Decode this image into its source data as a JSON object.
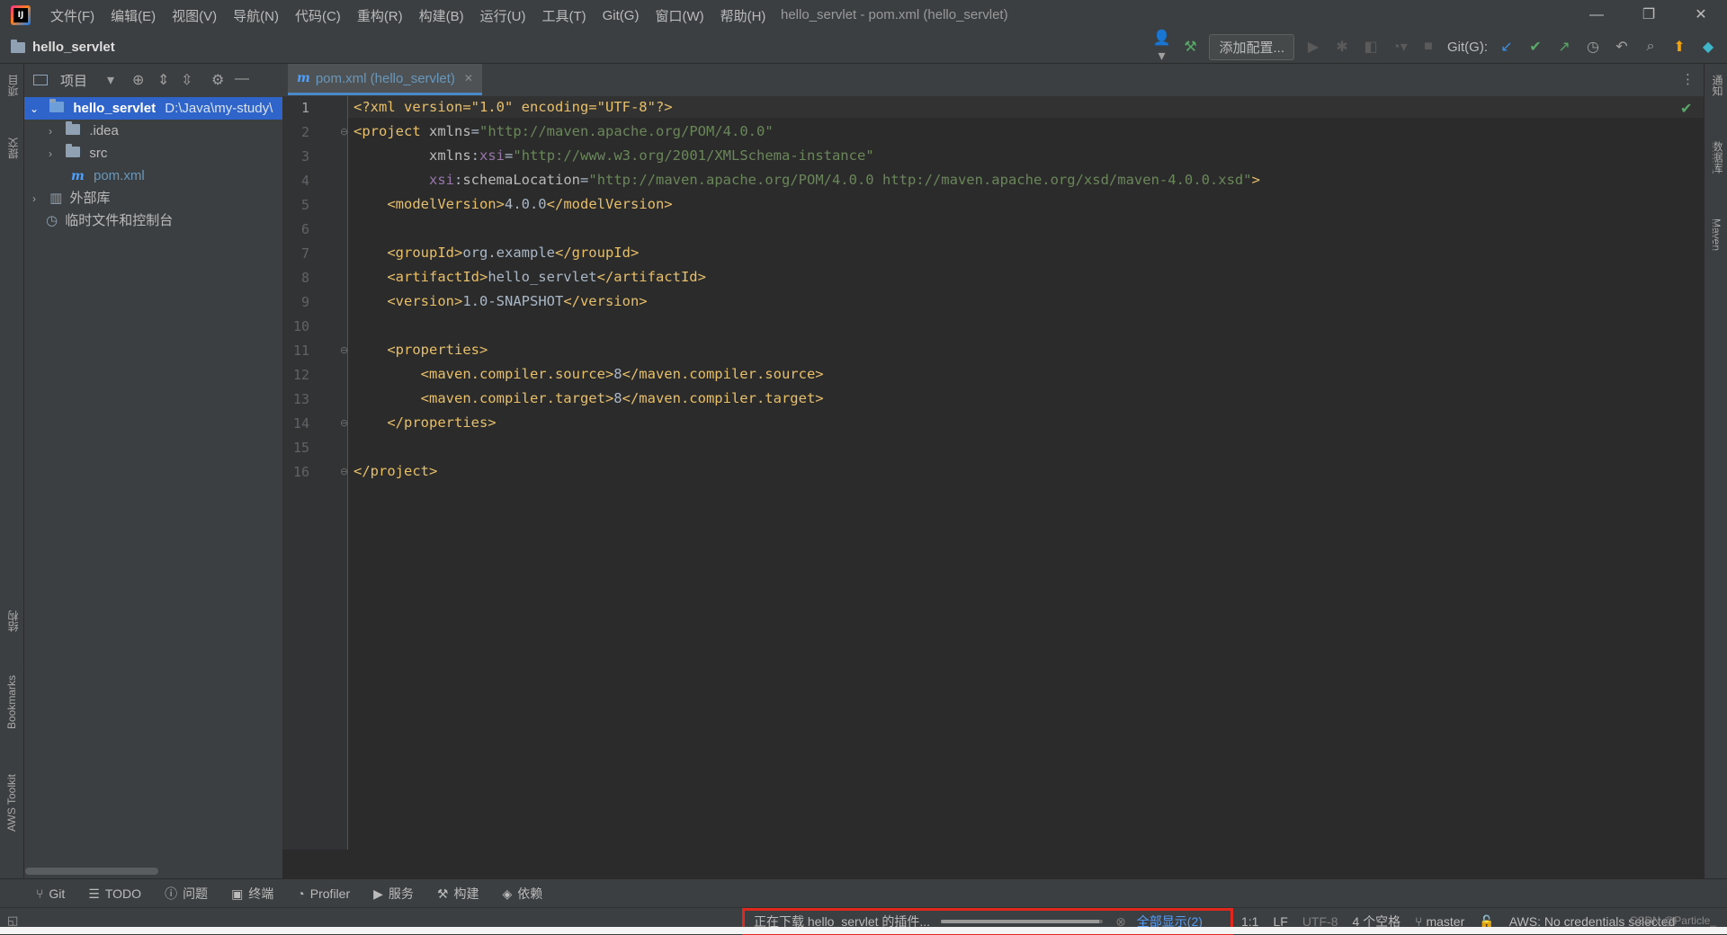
{
  "menu": [
    "文件(F)",
    "编辑(E)",
    "视图(V)",
    "导航(N)",
    "代码(C)",
    "重构(R)",
    "构建(B)",
    "运行(U)",
    "工具(T)",
    "Git(G)",
    "窗口(W)",
    "帮助(H)"
  ],
  "window_title": "hello_servlet - pom.xml (hello_servlet)",
  "nav": {
    "project": "hello_servlet",
    "add_config": "添加配置...",
    "git_label": "Git(G):"
  },
  "left_strip": {
    "project": "项目",
    "commit": "提交",
    "structure": "结构",
    "bookmarks": "Bookmarks",
    "aws": "AWS Toolkit"
  },
  "right_strip": {
    "notifications": "通知",
    "database": "数据库",
    "maven": "Maven"
  },
  "project_panel": {
    "title": "项目",
    "tree": [
      {
        "label": "hello_servlet",
        "path": "D:\\Java\\my-study\\",
        "selected": true
      },
      {
        "label": ".idea"
      },
      {
        "label": "src"
      },
      {
        "label": "pom.xml"
      },
      {
        "label": "外部库"
      },
      {
        "label": "临时文件和控制台"
      }
    ]
  },
  "editor": {
    "tab": "pom.xml (hello_servlet)",
    "line_numbers": [
      "1",
      "2",
      "3",
      "4",
      "5",
      "6",
      "7",
      "8",
      "9",
      "10",
      "11",
      "12",
      "13",
      "14",
      "15",
      "16"
    ],
    "xml": {
      "l1_decl": "<?xml version=\"1.0\" encoding=\"UTF-8\"?>",
      "xmlns": "http://maven.apache.org/POM/4.0.0",
      "xsi": "http://www.w3.org/2001/XMLSchema-instance",
      "schema_location": "http://maven.apache.org/POM/4.0.0 http://maven.apache.org/xsd/maven-4.0.0.xsd",
      "model_version": "4.0.0",
      "group_id": "org.example",
      "artifact_id": "hello_servlet",
      "version": "1.0-SNAPSHOT",
      "compiler_source": "8",
      "compiler_target": "8"
    }
  },
  "bottom_tools": [
    "Git",
    "TODO",
    "问题",
    "终端",
    "Profiler",
    "服务",
    "构建",
    "依赖"
  ],
  "status": {
    "progress_text": "正在下载 hello_servlet 的插件...",
    "progress": 0.98,
    "show_all": "全部显示(2)",
    "position": "1:1",
    "line_sep": "LF",
    "encoding": "UTF-8",
    "indent": "4 个空格",
    "branch": "master",
    "aws": "AWS: No credentials selected"
  },
  "watermark": "CSDN @Particle_"
}
